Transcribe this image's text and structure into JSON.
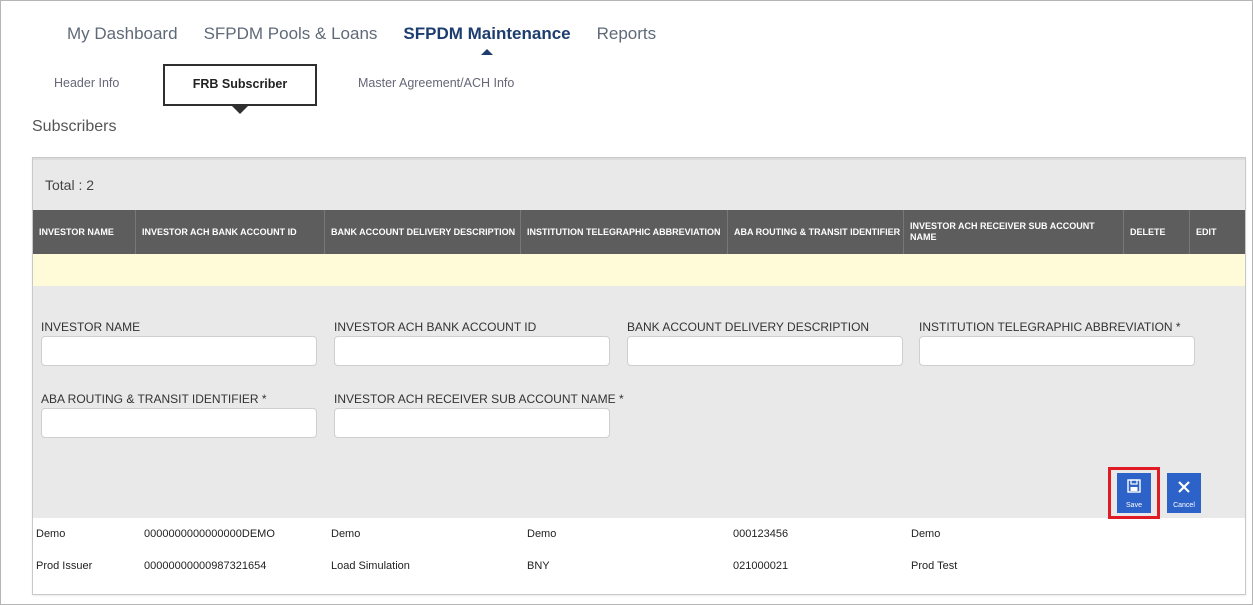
{
  "topnav": [
    {
      "label": "My Dashboard"
    },
    {
      "label": "SFPDM Pools & Loans"
    },
    {
      "label": "SFPDM Maintenance"
    },
    {
      "label": "Reports"
    }
  ],
  "subtabs": [
    {
      "label": "Header Info"
    },
    {
      "label": "FRB Subscriber"
    },
    {
      "label": "Master Agreement/ACH Info"
    }
  ],
  "section_title": "Subscribers",
  "total_label": "Total : 2",
  "columns": [
    "INVESTOR NAME",
    "INVESTOR ACH BANK ACCOUNT ID",
    "BANK ACCOUNT DELIVERY DESCRIPTION",
    "INSTITUTION TELEGRAPHIC ABBREVIATION",
    "ABA ROUTING & TRANSIT IDENTIFIER",
    "INVESTOR ACH RECEIVER SUB ACCOUNT NAME",
    "DELETE",
    "EDIT"
  ],
  "form": {
    "investor_name_label": "INVESTOR NAME",
    "investor_name_value": "",
    "ach_account_label": "INVESTOR ACH BANK ACCOUNT ID",
    "ach_account_value": "",
    "delivery_desc_label": "BANK ACCOUNT DELIVERY DESCRIPTION",
    "delivery_desc_value": "",
    "telegraphic_label": "INSTITUTION TELEGRAPHIC ABBREVIATION *",
    "telegraphic_value": "",
    "aba_label": "ABA ROUTING & TRANSIT IDENTIFIER *",
    "aba_value": "",
    "sub_account_label": "INVESTOR ACH RECEIVER SUB ACCOUNT NAME *",
    "sub_account_value": ""
  },
  "buttons": {
    "save_label": "Save",
    "cancel_label": "Cancel",
    "save_icon": "floppy-disk-icon",
    "cancel_icon": "close-icon",
    "highlight_color": "#e01b24"
  },
  "rows": [
    [
      "Demo",
      "0000000000000000DEMO",
      "Demo",
      "Demo",
      "000123456",
      "Demo"
    ],
    [
      "Prod Issuer",
      "00000000000987321654",
      "Load Simulation",
      "BNY",
      "021000021",
      "Prod Test"
    ]
  ],
  "colors": {
    "nav_active": "#1d3d6e",
    "table_header_bg": "#5d5d5d",
    "button_bg": "#2d63c8",
    "new_row_bg": "#fffbd8"
  }
}
